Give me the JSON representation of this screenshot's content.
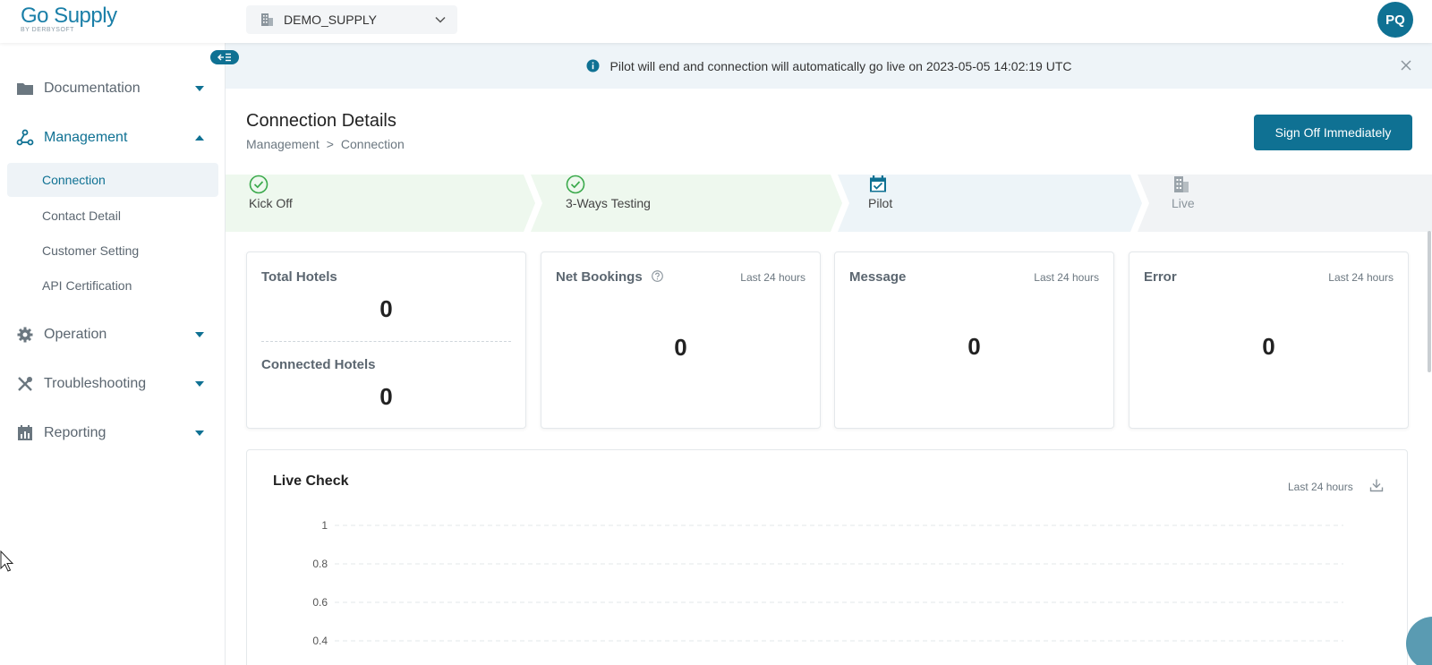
{
  "app": {
    "logo_main": "Go Supply",
    "logo_sub": "BY DERBYSOFT",
    "supplier": "DEMO_SUPPLY",
    "avatar_initials": "PQ",
    "accent_color": "#0f7193"
  },
  "sidebar": {
    "groups": [
      {
        "label": "Documentation",
        "icon": "folder-icon"
      },
      {
        "label": "Management",
        "icon": "network-icon"
      },
      {
        "label": "Operation",
        "icon": "gear-icon"
      },
      {
        "label": "Troubleshooting",
        "icon": "tools-icon"
      },
      {
        "label": "Reporting",
        "icon": "calendar-chart-icon"
      }
    ],
    "management_items": [
      "Connection",
      "Contact Detail",
      "Customer Setting",
      "API Certification"
    ],
    "active_item": "Connection"
  },
  "banner": {
    "text": "Pilot will end and connection will automatically go live on 2023-05-05 14:02:19 UTC"
  },
  "header": {
    "title": "Connection Details",
    "breadcrumb": [
      "Management",
      "Connection"
    ],
    "breadcrumb_sep": ">",
    "signoff_label": "Sign Off Immediately"
  },
  "steps": [
    {
      "label": "Kick Off",
      "status": "done"
    },
    {
      "label": "3-Ways Testing",
      "status": "done"
    },
    {
      "label": "Pilot",
      "status": "current"
    },
    {
      "label": "Live",
      "status": "pending"
    }
  ],
  "stats": {
    "total_hotels": {
      "label": "Total Hotels",
      "value": "0"
    },
    "connected_hotels": {
      "label": "Connected Hotels",
      "value": "0"
    },
    "net_bookings": {
      "label": "Net Bookings",
      "range": "Last 24 hours",
      "value": "0"
    },
    "message": {
      "label": "Message",
      "range": "Last 24 hours",
      "value": "0"
    },
    "error": {
      "label": "Error",
      "range": "Last 24 hours",
      "value": "0"
    }
  },
  "live_check": {
    "title": "Live Check",
    "range": "Last 24 hours"
  },
  "chart_data": {
    "type": "line",
    "title": "Live Check",
    "y_ticks": [
      "1",
      "0.8",
      "0.6",
      "0.4"
    ],
    "ylim": [
      0.4,
      1
    ],
    "grid": true
  }
}
